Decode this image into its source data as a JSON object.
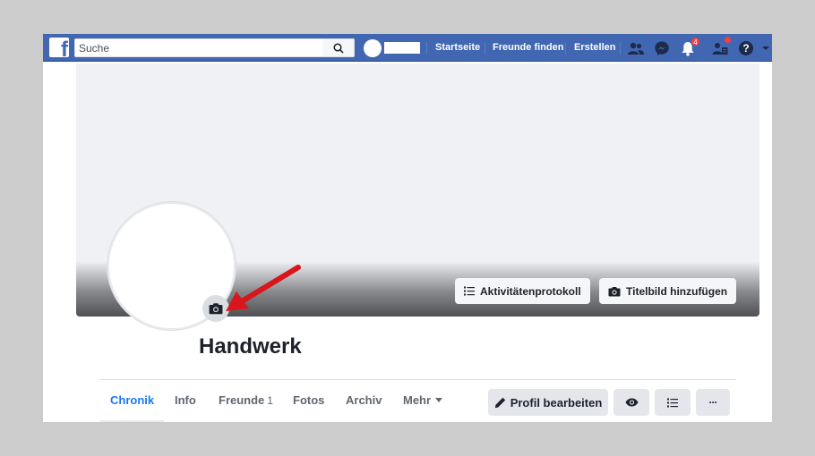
{
  "topbar": {
    "logo": "f",
    "search_placeholder": "Suche",
    "nav_links": [
      "Startseite",
      "Freunde finden",
      "Erstellen"
    ],
    "icons": {
      "friends": "friend-requests-icon",
      "messenger": "messenger-icon",
      "notifications": "notifications-icon",
      "notifications_badge": "4",
      "groups": "groups-icon",
      "help": "help-icon"
    }
  },
  "cover": {
    "buttons": {
      "activity_log": "Aktivitätenprotokoll",
      "add_cover": "Titelbild hinzufügen"
    }
  },
  "profile": {
    "name": "Handwerk"
  },
  "tabs": [
    {
      "label": "Chronik",
      "active": true
    },
    {
      "label": "Info"
    },
    {
      "label": "Freunde",
      "count": "1"
    },
    {
      "label": "Fotos"
    },
    {
      "label": "Archiv"
    },
    {
      "label": "Mehr"
    }
  ],
  "actions": {
    "edit_profile": "Profil bearbeiten",
    "more": "···"
  },
  "colors": {
    "brand_blue": "#4267b2",
    "active_tab": "#1877f2",
    "arrow_red": "#d9161c",
    "badge_red": "#fa3e3e"
  }
}
